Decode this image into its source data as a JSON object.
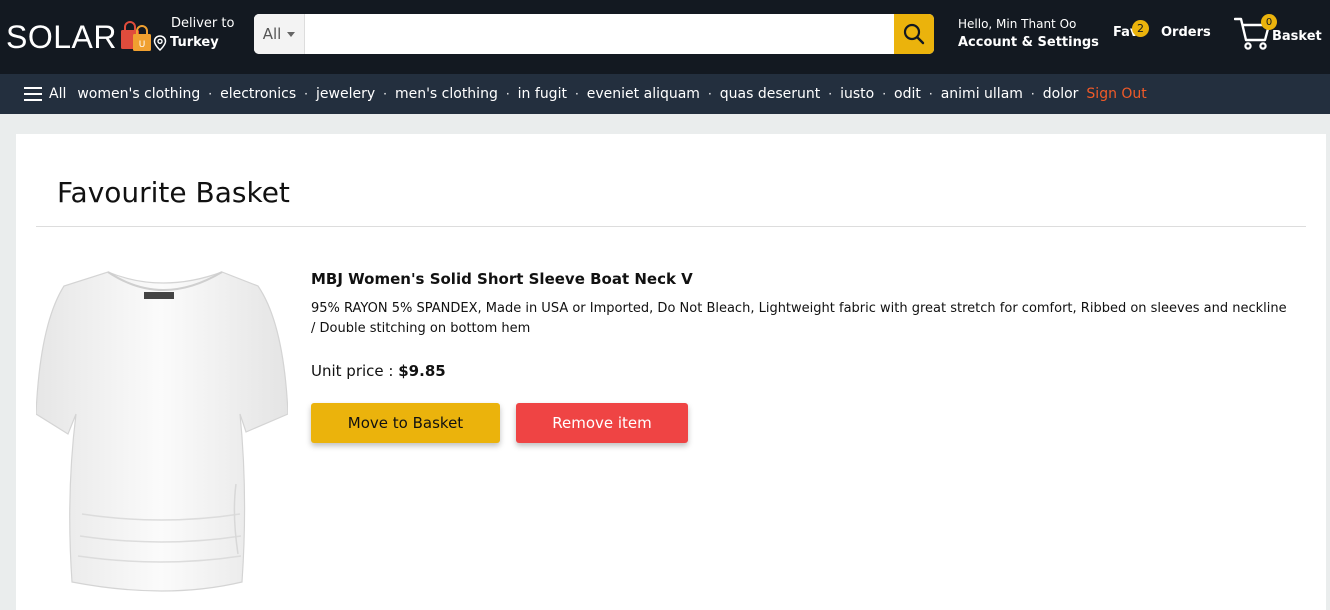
{
  "header": {
    "logo_text": "SOLAR",
    "logo_bag_letter": "U",
    "deliver_label": "Deliver to",
    "deliver_country": "Turkey",
    "search": {
      "category": "All",
      "placeholder": "",
      "value": ""
    },
    "account_hello": "Hello, Min Thant Oo",
    "account_settings": "Account & Settings",
    "fav_label": "Fav",
    "fav_count": "2",
    "orders_label": "Orders",
    "basket_label": "Basket",
    "basket_count": "0"
  },
  "nav": {
    "all_label": "All",
    "categories": [
      "women's clothing",
      "electronics",
      "jewelery",
      "men's clothing",
      "in fugit",
      "eveniet aliquam",
      "quas deserunt",
      "iusto",
      "odit",
      "animi ullam",
      "dolor"
    ],
    "sign_out": "Sign Out"
  },
  "page": {
    "title": "Favourite Basket",
    "item": {
      "name": "MBJ Women's Solid Short Sleeve Boat Neck V",
      "description": "95% RAYON 5% SPANDEX, Made in USA or Imported, Do Not Bleach, Lightweight fabric with great stretch for comfort, Ribbed on sleeves and neckline / Double stitching on bottom hem",
      "price_label": "Unit price :",
      "price": "$9.85",
      "move_button": "Move to Basket",
      "remove_button": "Remove item"
    }
  },
  "colors": {
    "header_bg": "#131921",
    "nav_bg": "#232f3e",
    "accent": "#ebb30c",
    "danger": "#ef4444",
    "sign_out": "#f05a28"
  }
}
